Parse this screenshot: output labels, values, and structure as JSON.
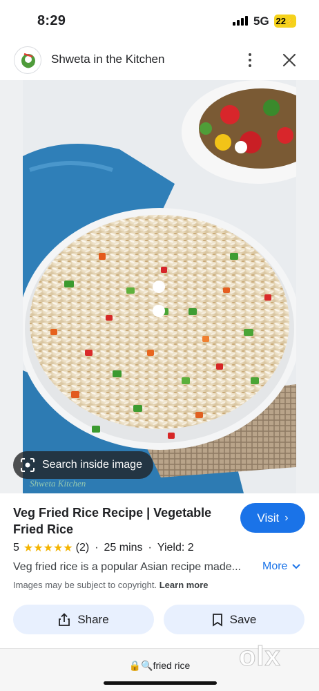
{
  "status_bar": {
    "time": "8:29",
    "network": "5G",
    "battery": "22"
  },
  "header": {
    "site_name": "Shweta in the Kitchen",
    "logo_icon": "chef-logo-icon",
    "menu_icon": "more-vert-icon",
    "close_icon": "close-icon"
  },
  "image": {
    "search_inside_label": "Search inside image",
    "watermark_text": "Shweta Kitchen"
  },
  "result": {
    "title": "Veg Fried Rice Recipe | Vegetable Fried Rice",
    "visit_label": "Visit",
    "rating": "5",
    "stars": "★★★★★",
    "review_count": "(2)",
    "time": "25 mins",
    "yield": "Yield: 2",
    "description": "Veg fried rice is a popular Asian recipe made...",
    "more_label": "More",
    "copyright_text": "Images may be subject to copyright.",
    "learn_more": "Learn more"
  },
  "actions": {
    "share_label": "Share",
    "save_label": "Save"
  },
  "url_bar": {
    "query": "fried rice"
  },
  "overlay": {
    "watermark": "olx"
  },
  "colors": {
    "accent": "#1a73e8",
    "button_bg": "#e8f0fe",
    "star": "#f4b400",
    "battery": "#f5d21c"
  }
}
